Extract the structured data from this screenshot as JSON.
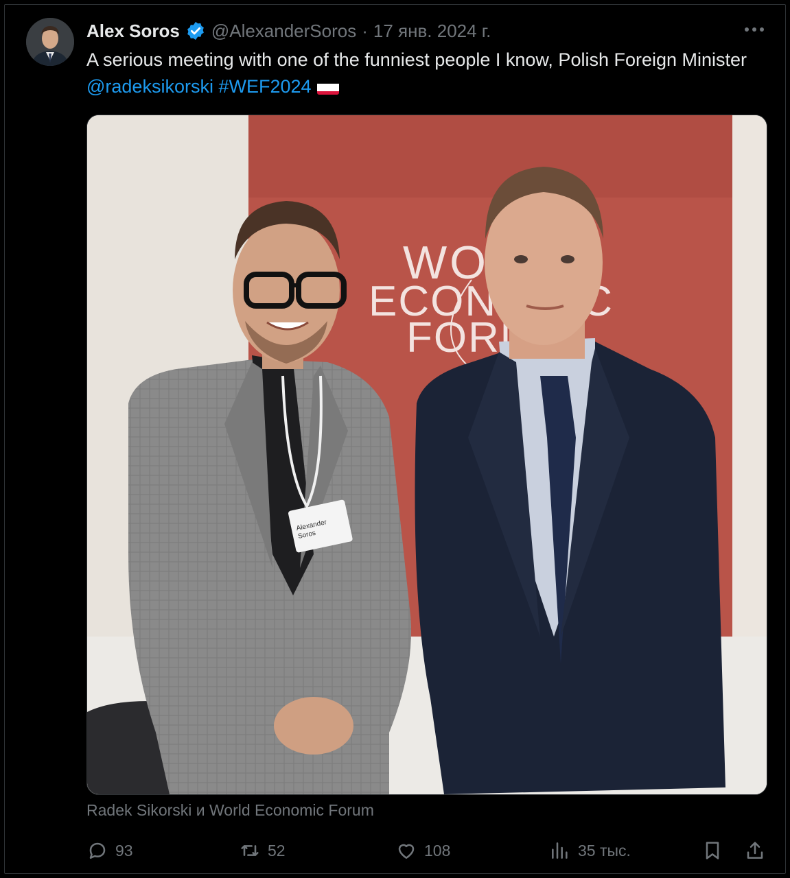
{
  "tweet": {
    "author_name": "Alex Soros",
    "verified_icon": "verified-badge-icon",
    "handle": "@AlexanderSoros",
    "separator": "·",
    "date": "17 янв. 2024 г.",
    "text_before": "A serious meeting with one of the funniest people I know, Polish Foreign Minister ",
    "mention": "@radeksikorski",
    "space": " ",
    "hashtag": "#WEF2024",
    "flag_icon": "poland-flag-icon",
    "tagged_people": "Radek Sikorski и World Economic Forum"
  },
  "photo": {
    "backdrop_text": [
      "WORLD",
      "ECONOMIC",
      "FORUM"
    ],
    "badge_text": [
      "Alexander",
      "Soros"
    ]
  },
  "actions": {
    "replies": "93",
    "reposts": "52",
    "likes": "108",
    "views": "35 тыс."
  },
  "colors": {
    "accent": "#1d9bf0",
    "muted": "#71767b",
    "text": "#e7e9ea",
    "background": "#000000"
  }
}
